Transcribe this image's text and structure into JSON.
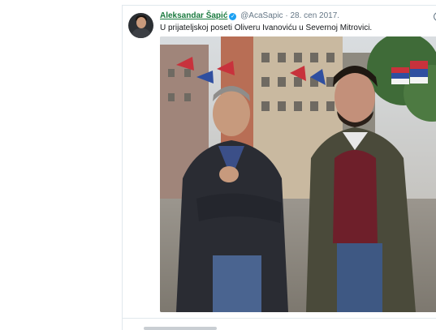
{
  "tweet": {
    "author_name": "Aleksandar Šapić",
    "verified": "verified-badge-icon",
    "handle": "@AcaSapic",
    "separator": "·",
    "date": "28. cen 2017.",
    "text": "U prijateljskoj poseti Oliveru Ivanoviću u Severnoj Mitrovici.",
    "menu_icon": "caret-down-icon"
  },
  "colors": {
    "author_link": "#1a7a3f",
    "muted": "#657786",
    "verified": "#1da1f2",
    "border": "#e1e8ed"
  }
}
